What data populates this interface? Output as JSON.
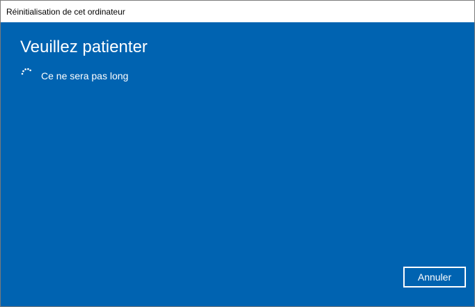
{
  "window": {
    "title": "Réinitialisation de cet ordinateur"
  },
  "main": {
    "heading": "Veuillez patienter",
    "status": "Ce ne sera pas long",
    "spinner_icon": "loading-spinner-icon"
  },
  "actions": {
    "cancel_label": "Annuler"
  },
  "colors": {
    "background": "#0063b1",
    "text": "#ffffff",
    "titlebar": "#ffffff"
  }
}
